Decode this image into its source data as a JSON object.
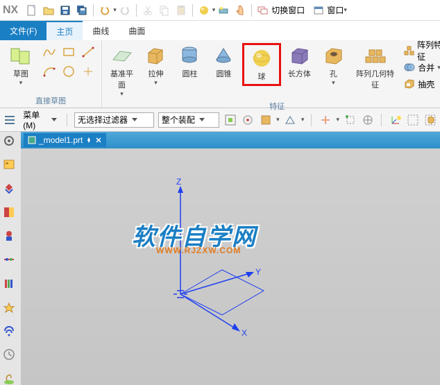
{
  "app": {
    "logo": "NX"
  },
  "titlebar": {
    "switch_window": "切换窗口",
    "window": "窗口"
  },
  "menu": {
    "file": "文件(F)",
    "home": "主页",
    "curve": "曲线",
    "surface": "曲面"
  },
  "ribbon": {
    "sketch_group": "直接草图",
    "sketch": "草图",
    "feature_group": "特征",
    "datum_plane": "基准平面",
    "extrude": "拉伸",
    "cylinder": "圆柱",
    "cone": "圆锥",
    "sphere": "球",
    "cuboid": "长方体",
    "hole": "孔",
    "pattern_geom": "阵列几何特征",
    "pattern_feature": "阵列特征",
    "unite": "合并",
    "shell": "抽壳"
  },
  "filter": {
    "menu_btn": "菜单(M)",
    "no_filter": "无选择过滤器",
    "whole_asm": "整个装配"
  },
  "doc": {
    "name": "_model1.prt"
  },
  "canvas": {
    "axis_x": "X",
    "axis_y": "Y",
    "axis_z": "Z",
    "watermark": "软件自学网",
    "watermark_sub": "WWW.RJZXW.COM"
  }
}
